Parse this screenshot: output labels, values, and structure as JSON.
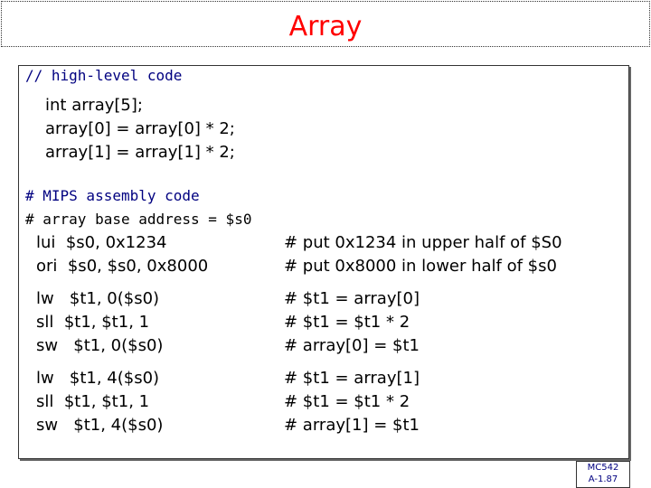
{
  "title": "Array",
  "high_level": {
    "comment": "// high-level code",
    "lines": [
      "int array[5];",
      "array[0] = array[0] * 2;",
      "array[1] = array[1] * 2;"
    ]
  },
  "mips": {
    "comment1": "# MIPS assembly code",
    "comment2": "# array base address = $s0",
    "rows": [
      {
        "instr": "lui  $s0, 0x1234",
        "comment": "# put 0x1234 in upper half of $S0"
      },
      {
        "instr": "ori  $s0, $s0, 0x8000",
        "comment": "# put 0x8000 in lower half of $s0"
      },
      {
        "instr": "lw   $t1, 0($s0)",
        "comment": "# $t1 = array[0]"
      },
      {
        "instr": "sll  $t1, $t1, 1",
        "comment": "# $t1 = $t1 * 2"
      },
      {
        "instr": "sw   $t1, 0($s0)",
        "comment": "# array[0] = $t1"
      },
      {
        "instr": "lw   $t1, 4($s0)",
        "comment": "# $t1 = array[1]"
      },
      {
        "instr": "sll  $t1, $t1, 1",
        "comment": "# $t1 = $t1 * 2"
      },
      {
        "instr": "sw   $t1, 4($s0)",
        "comment": "# array[1] = $t1"
      }
    ]
  },
  "footer": {
    "line1": "MC542",
    "line2": "A-1.87"
  },
  "colors": {
    "title": "#ff0000",
    "comment": "#000080"
  }
}
